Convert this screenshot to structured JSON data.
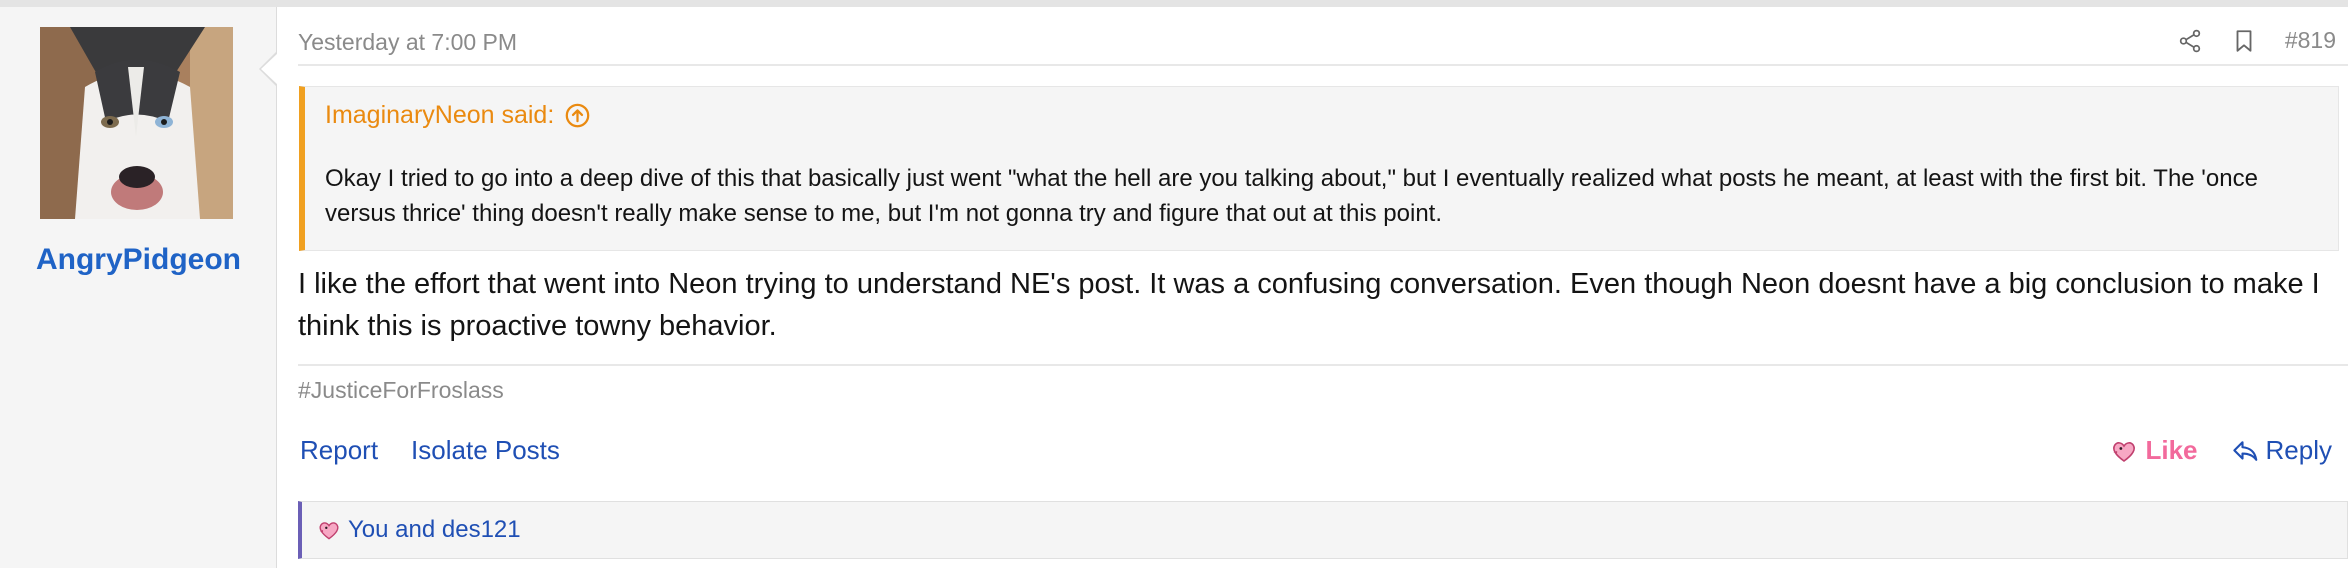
{
  "author": {
    "username": "AngryPidgeon",
    "avatar_icon": "husky-dog-avatar"
  },
  "post": {
    "timestamp": "Yesterday at 7:00 PM",
    "post_number": "#819",
    "quote": {
      "author_label": "ImaginaryNeon said:",
      "body": "Okay I tried to go into a deep dive of this that basically just went \"what the hell are you talking about,\" but I eventually realized what posts he meant, at least with the first bit. The 'once versus thrice' thing doesn't really make sense to me, but I'm not gonna try and figure that out at this point."
    },
    "message": "I like the effort that went into Neon trying to understand NE's post. It was a confusing conversation. Even though Neon doesnt have a big conclusion to make I think this is proactive towny behavior.",
    "signature": "#JusticeForFroslass"
  },
  "actions": {
    "report": "Report",
    "isolate": "Isolate Posts",
    "like": "Like",
    "reply": "Reply"
  },
  "reactions": {
    "summary": "You and des121"
  },
  "colors": {
    "username": "#1f63c6",
    "quote_accent": "#f0a020",
    "like": "#f26a9c",
    "link": "#1f4fb4",
    "reaction_accent": "#6b5fb6"
  }
}
